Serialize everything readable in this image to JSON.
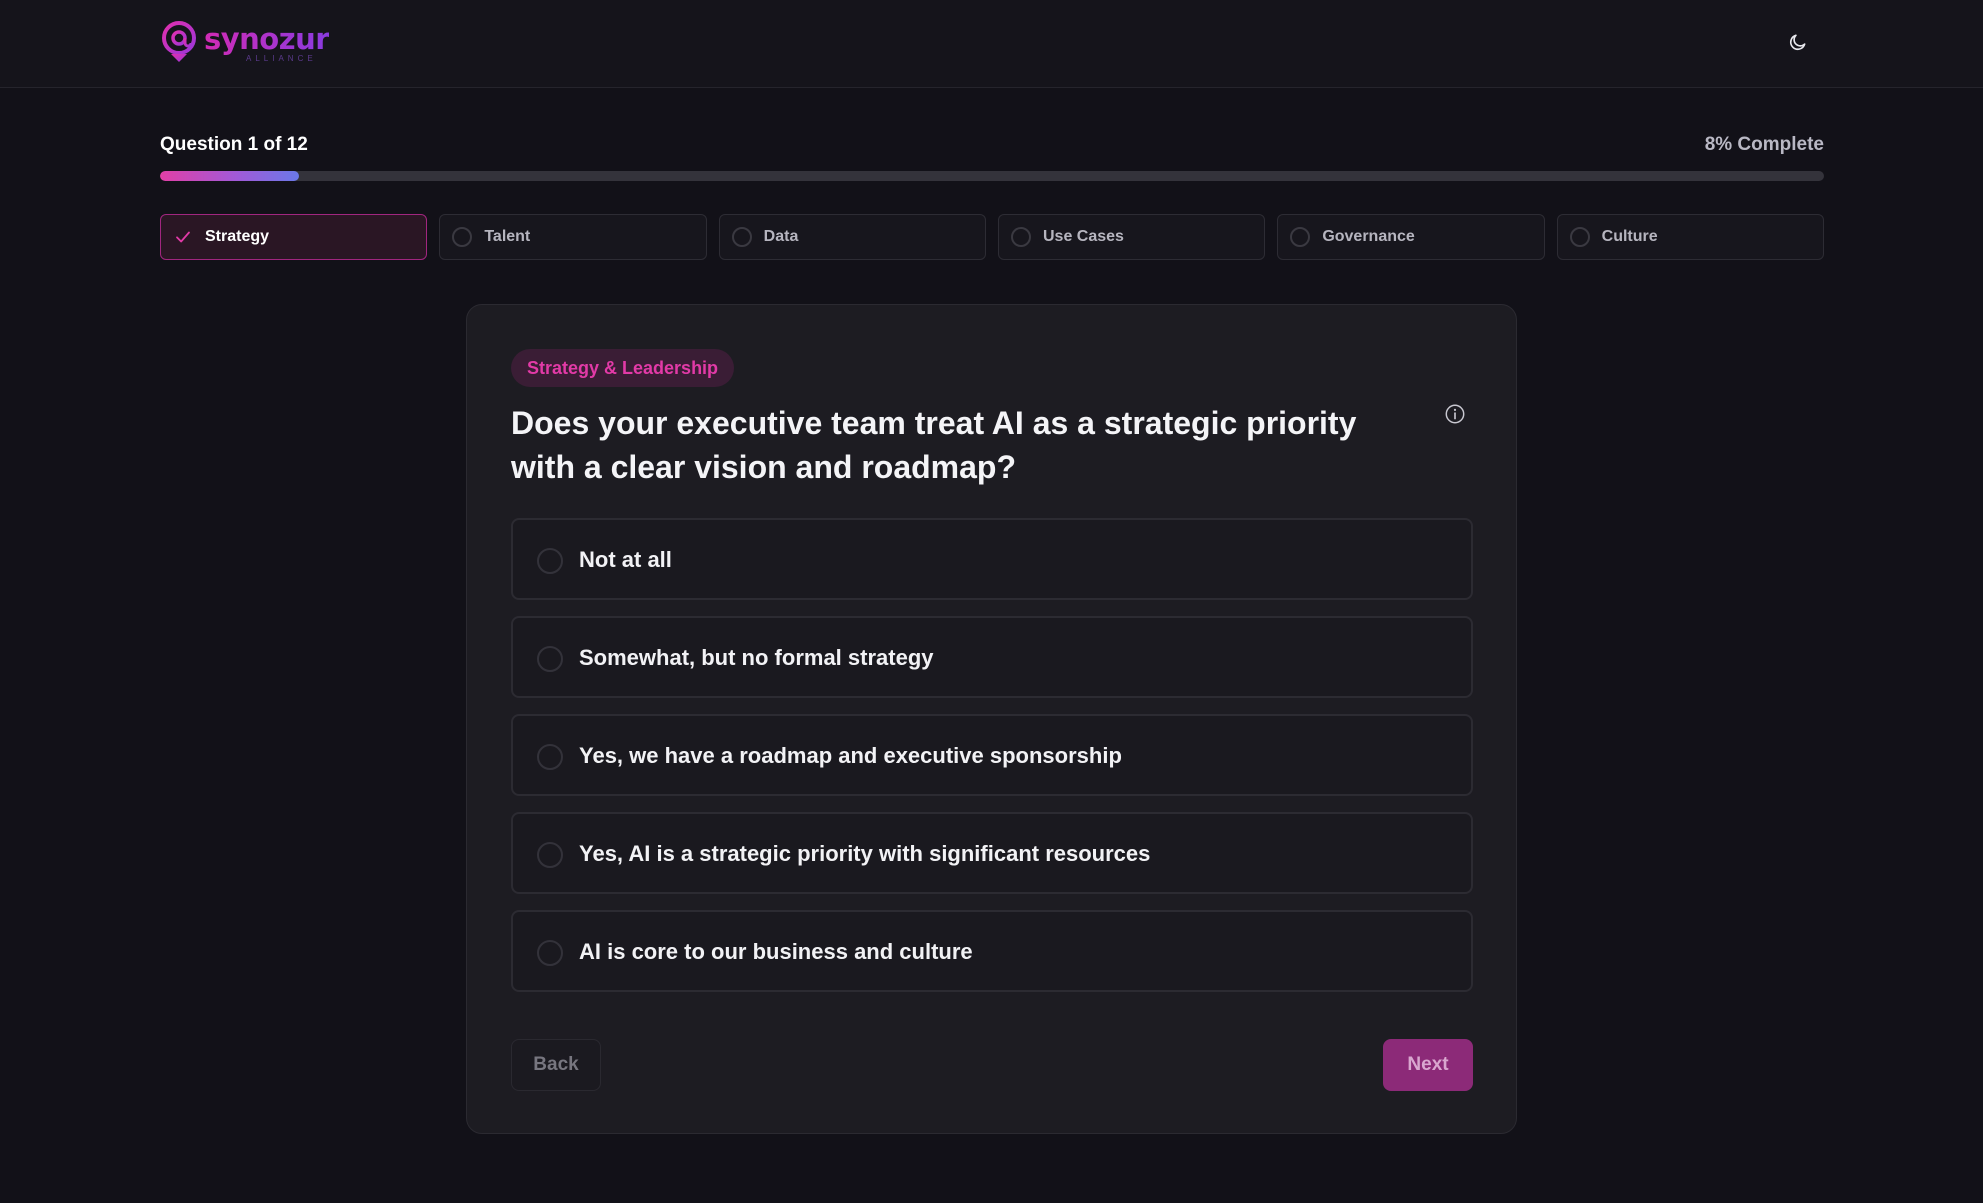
{
  "header": {
    "logo_word": "synozur",
    "logo_subtext": "ALLIANCE",
    "theme_toggle_icon": "moon-icon"
  },
  "progress": {
    "question_label": "Question 1 of 12",
    "percent_label": "8% Complete",
    "percent_value": 8.33,
    "gradient_colors": [
      "#e13fa6",
      "#a15ad8",
      "#6a79e8"
    ]
  },
  "steps": [
    {
      "label": "Strategy",
      "state": "active",
      "icon": "check-icon"
    },
    {
      "label": "Talent",
      "state": "pending",
      "icon": "circle-icon"
    },
    {
      "label": "Data",
      "state": "pending",
      "icon": "circle-icon"
    },
    {
      "label": "Use Cases",
      "state": "pending",
      "icon": "circle-icon"
    },
    {
      "label": "Governance",
      "state": "pending",
      "icon": "circle-icon"
    },
    {
      "label": "Culture",
      "state": "pending",
      "icon": "circle-icon"
    }
  ],
  "question_card": {
    "category": "Strategy & Leadership",
    "question": "Does your executive team treat AI as a strategic priority with a clear vision and roadmap?",
    "info_icon": "info-icon",
    "options": [
      "Not at all",
      "Somewhat, but no formal strategy",
      "Yes, we have a roadmap and executive sponsorship",
      "Yes, AI is a strategic priority with significant resources",
      "AI is core to our business and culture"
    ],
    "back_label": "Back",
    "next_label": "Next"
  },
  "colors": {
    "accent": "#e23aa7",
    "next_button": "#8c2a78",
    "background": "#121118",
    "card": "#1d1c22"
  }
}
